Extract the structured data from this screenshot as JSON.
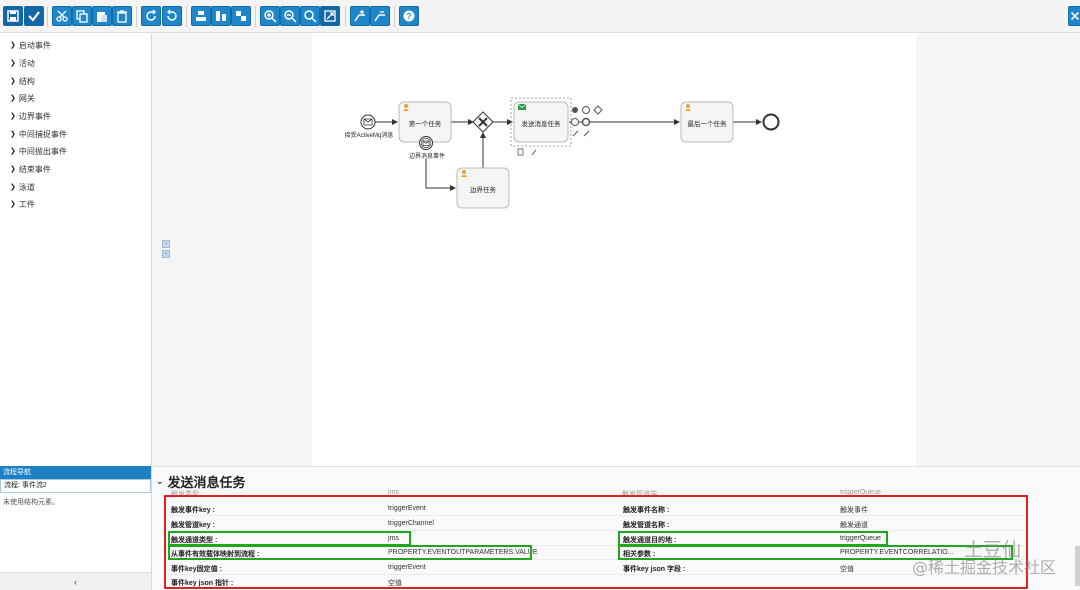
{
  "toolbar": {
    "buttons": [
      "save-icon",
      "check-icon",
      "cut-icon",
      "copy-icon",
      "paste-icon",
      "delete-icon",
      "redo-icon",
      "undo-icon",
      "align-icon",
      "same-size-icon",
      "same-width-icon",
      "zoom-in-icon",
      "zoom-out-icon",
      "zoom-actual-icon",
      "zoom-fit-icon",
      "bend-add-icon",
      "bend-remove-icon",
      "help-icon"
    ],
    "close_icon": "close-icon"
  },
  "palette": {
    "items": [
      "启动事件",
      "活动",
      "结构",
      "网关",
      "边界事件",
      "中间捕捉事件",
      "中间抛出事件",
      "结束事件",
      "泳道",
      "工件"
    ]
  },
  "diagram": {
    "start_label": "接受ActiveMq消息",
    "task1": "第一个任务",
    "boundary_label": "边界消息事件",
    "boundary_task": "边界任务",
    "send_task": "发送消息任务",
    "last_task": "最后一个任务"
  },
  "navigator": {
    "title": "流程导航",
    "selected": "流程: 事件流2",
    "note": "未使用结构元素。",
    "collapse": "‹"
  },
  "properties": {
    "title": "发送消息任务",
    "ghost_left": "触发类型:",
    "ghost_left_val": "jms",
    "ghost_right": "触发管道端:",
    "ghost_right_val": "triggerQueue",
    "left_rows": [
      {
        "label": "触发事件key :",
        "value": "triggerEvent"
      },
      {
        "label": "触发管道key :",
        "value": "triggerChannel"
      },
      {
        "label": "触发通道类型 :",
        "value": "jms"
      },
      {
        "label": "从事件有效载体映射到流程 :",
        "value": "PROPERTY.EVENTOUTPARAMETERS.VALUE"
      },
      {
        "label": "事件key固定值 :",
        "value": "triggerEvent"
      },
      {
        "label": "事件key json 指针 :",
        "value": "空值"
      }
    ],
    "right_rows": [
      {
        "label": "触发事件名称 :",
        "value": "触发事件"
      },
      {
        "label": "触发管道名称 :",
        "value": "触发通道"
      },
      {
        "label": "触发通道目的地 :",
        "value": "triggerQueue"
      },
      {
        "label": "相关参数 :",
        "value": "PROPERTY.EVENTCORRELATIO..."
      },
      {
        "label": "事件key json 字段 :",
        "value": "空值"
      }
    ]
  },
  "watermark": {
    "line1": "土豆仙",
    "line2": "@稀土掘金技术社区"
  },
  "colors": {
    "accent": "#1f86c9",
    "highlight_red": "#e02020",
    "highlight_green": "#1fa81f",
    "task_icon": "#f0a030",
    "send_icon": "#2a9a3a"
  }
}
